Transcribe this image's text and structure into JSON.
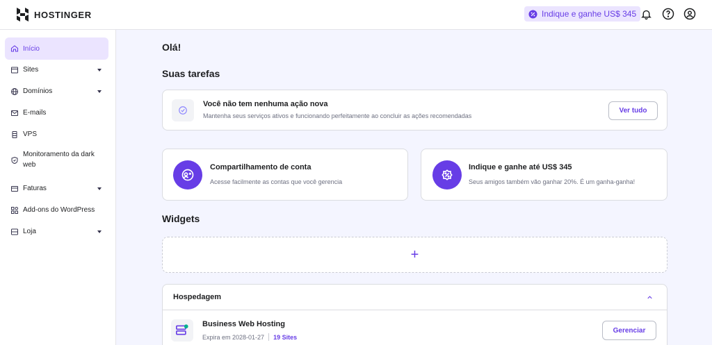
{
  "header": {
    "logo_text": "HOSTINGER",
    "referral_label": "Indique e ganhe US$ 345"
  },
  "sidebar": {
    "items": [
      {
        "label": "Início",
        "icon": "home-icon",
        "has_chevron": false,
        "active": true
      },
      {
        "label": "Sites",
        "icon": "browser-icon",
        "has_chevron": true
      },
      {
        "label": "Domínios",
        "icon": "globe-icon",
        "has_chevron": true
      },
      {
        "label": "E-mails",
        "icon": "mail-icon",
        "has_chevron": false
      },
      {
        "label": "VPS",
        "icon": "server-icon",
        "has_chevron": false
      },
      {
        "label": "Monitoramento da dark web",
        "icon": "shield-icon",
        "has_chevron": false
      },
      {
        "label": "Faturas",
        "icon": "credit-card-icon",
        "has_chevron": true
      },
      {
        "label": "Add-ons do WordPress",
        "icon": "addons-icon",
        "has_chevron": false
      },
      {
        "label": "Loja",
        "icon": "store-icon",
        "has_chevron": true
      }
    ]
  },
  "main": {
    "greeting": "Olá!",
    "tasks_heading": "Suas tarefas",
    "tasks_card": {
      "title": "Você não tem nenhuma ação nova",
      "subtitle": "Mantenha seus serviços ativos e funcionando perfeitamente ao concluir as ações recomendadas",
      "button": "Ver tudo"
    },
    "share_card": {
      "title": "Compartilhamento de conta",
      "subtitle": "Acesse facilmente as contas que você gerencia"
    },
    "refer_card": {
      "title": "Indique e ganhe até US$ 345",
      "subtitle": "Seus amigos também vão ganhar 20%. É um ganha-ganha!"
    },
    "widgets_heading": "Widgets",
    "add_widget_symbol": "+",
    "hosting": {
      "header": "Hospedagem",
      "plan_title": "Business Web Hosting",
      "expires": "Expira em 2028-01-27",
      "sites": "19 Sites",
      "button": "Gerenciar"
    }
  },
  "colors": {
    "accent": "#673de6",
    "accent_light": "#ebe4ff",
    "page_bg": "#f4f5ff"
  }
}
